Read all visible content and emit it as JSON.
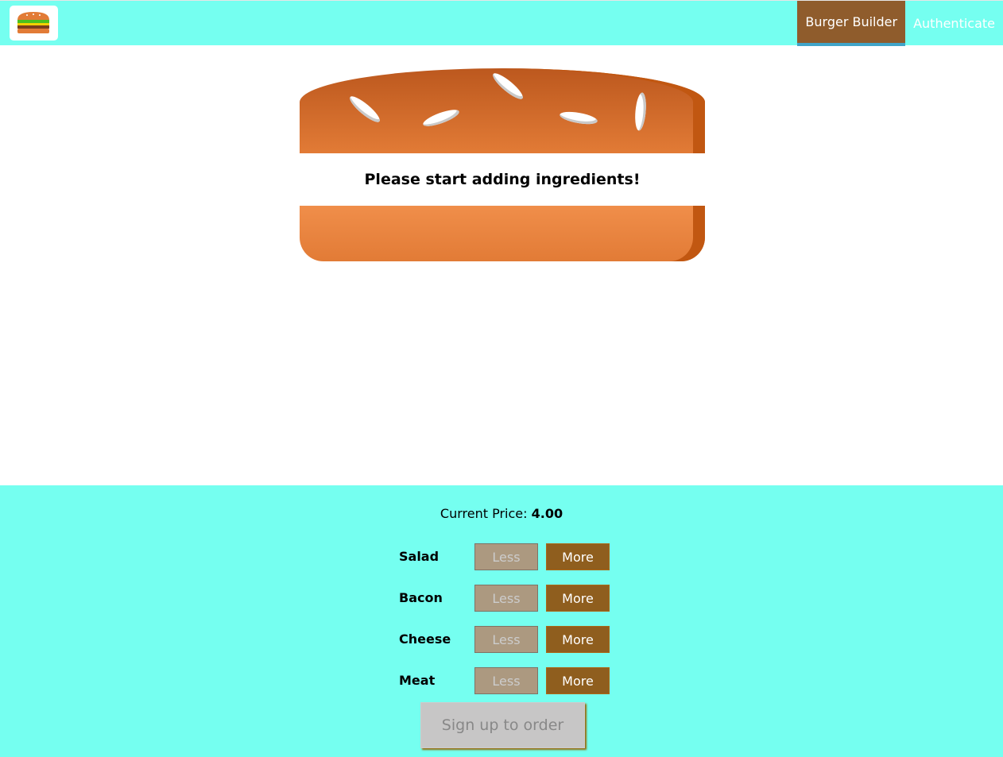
{
  "nav": {
    "items": [
      {
        "label": "Burger Builder",
        "active": true
      },
      {
        "label": "Authenticate",
        "active": false
      }
    ]
  },
  "burger": {
    "message": "Please start adding ingredients!"
  },
  "controls": {
    "price_label": "Current Price:",
    "price_value": "4.00",
    "ingredients": [
      {
        "label": "Salad",
        "less": "Less",
        "more": "More"
      },
      {
        "label": "Bacon",
        "less": "Less",
        "more": "More"
      },
      {
        "label": "Cheese",
        "less": "Less",
        "more": "More"
      },
      {
        "label": "Meat",
        "less": "Less",
        "more": "More"
      }
    ],
    "order_button": "Sign up to order"
  }
}
